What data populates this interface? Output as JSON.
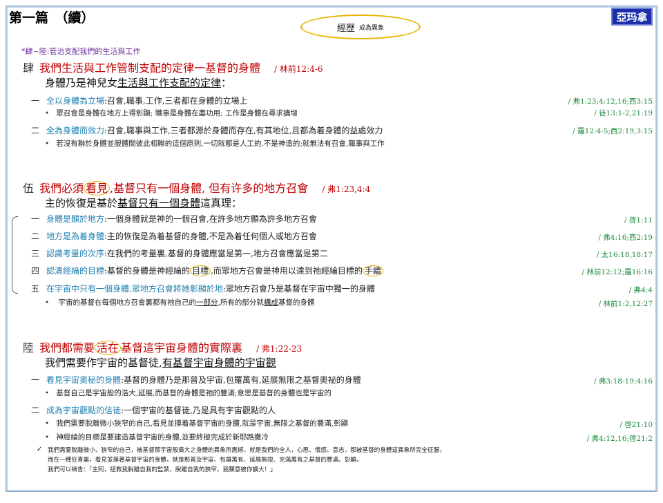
{
  "page": {
    "title": "第一篇　（續）",
    "logo": "亞玛拿"
  },
  "oval": {
    "main": "經歷",
    "sub": "成為異象"
  },
  "crumb": "*肆~陸:管治支配我們的生活與工作",
  "s4": {
    "num": "肆",
    "head": "我們生活與工作管制支配的定律一基督的身體",
    "ref": "/ 林前12:4-6",
    "subtitle_a": "身體乃是神兒女",
    "subtitle_u": "生活與工作支配的定律",
    "subtitle_b": "：",
    "i1": {
      "n": "一",
      "t": "全以身體為立場",
      "b": ":召會,職事,工作,三者都在身體的立場上",
      "ref": "/ 弗1:23;4:12,16;西3:15"
    },
    "b1": {
      "text": "眾召會是身體在地方上得彰顯; 職事是身體在盡功用; 工作是身體在尋求擴增",
      "ref": "/ 徒13:1-2,21:19"
    },
    "i2": {
      "n": "二",
      "t": "全為身體而效力",
      "b": ":召會,職事與工作,三者都源於身體而存在,有其地位,且都為着身體的益處效力",
      "ref": "/ 羅12:4-5;西2:19,3:15"
    },
    "b2": {
      "text": "若沒有聯於身體並服體間彼此相聯的這個原則,一切就都是人工的,不是神造的;就無法有召會,職事與工作"
    }
  },
  "s5": {
    "num": "伍",
    "head_a": "我們必須",
    "head_c": "看見",
    "head_b": ",基督只有一個身體, 但有许多的地方召會",
    "ref": "/ 弗1:23,4:4",
    "subtitle_a": "主的恢復是基於",
    "subtitle_u": "基督只有一個身體",
    "subtitle_b": "這真理：",
    "i1": {
      "n": "一",
      "t": "身體是顯於地方",
      "b": ":一個身體就是神的一個召會,在許多地方顯為許多地方召會",
      "ref": "/ 啓1:11"
    },
    "i2": {
      "n": "二",
      "t": "地方是為着身體",
      "b": ":主的恢復是為着基督的身體,不是為着任何個人或地方召會",
      "ref": "/ 弗4:16;西2:19"
    },
    "i3": {
      "n": "三",
      "t": "認識考量的次序",
      "b": ":在我們的考量裏,基督的身體應當是第一,地方召會應當是第二",
      "ref": "/ 太16:18,18:17"
    },
    "i4": {
      "n": "四",
      "t": "認清經綸的目標",
      "b_a": ":基督的身體是神經綸的",
      "b_c1": "目標",
      "b_b": ",而眾地方召會是神用以達到祂經綸目標的",
      "b_c2": "手續",
      "ref": "/ 林前12:12;羅16:16"
    },
    "i5": {
      "n": "五",
      "t": "在宇宙中只有一個身體,眾地方召會將她彰顯於地",
      "b": ":眾地方召會乃是基督在宇宙中獨一的身體",
      "ref": "/ 弗4:4"
    },
    "b1": {
      "a": "宇宙的基督在每個地方召會裏都有祂自己的",
      "u1": "一部分",
      "b": ",所有的部分就",
      "u2": "構成",
      "c": "基督的身體",
      "ref": "/ 林前1:2,12:27"
    }
  },
  "s6": {
    "num": "陸",
    "head_a": "我們都需要",
    "head_c": "活在",
    "head_b": "基督這宇宙身體的實際裏",
    "ref": "/ 弗1:22-23",
    "subtitle_a": "我們需要作宇宙的基督徒,",
    "subtitle_u": "有基督宇宙身體的宇宙觀",
    "i1": {
      "n": "一",
      "t": "看見宇宙奧秘的身體",
      "b": ":基督的身體乃是那普及宇宙,包羅萬有,延展無限之基督奧祕的身體",
      "ref": "/ 弗3:18-19;4:16"
    },
    "b1": {
      "text": "基督自己是宇宙般的浩大,延展,而基督的身體是祂的豐滿;意思是基督的身體也是宇宙的"
    },
    "i2": {
      "n": "二",
      "t": "成為宇宙觀點的信徒",
      "b": ":一個宇宙的基督徒,乃是具有宇宙觀點的人"
    },
    "b2": {
      "text": "我們需要脫離微小狹窄的自己,看見並摸着基督宇宙的身體,就是宇宙,無限之基督的豐滿,彰顯",
      "ref": "/ 啓21:10"
    },
    "b3": {
      "text": "神經綸的目標是要建造基督宇宙的身體,並要終極完成於新耶路撒冷",
      "ref": "/ 弗4:12,16;啓21:2"
    },
    "note1": "我們需要脫離微小、狹窄的自己，被基督那宇宙般廣大之身體的異象所震撼，就是我們的全人，心思、情感、意志，都被基督的身體這異象所完全征服，",
    "note2": "而在一種狂喜裏，看見並摸著基督宇宙的身體，就是那普及宇宙、包羅萬有、延展無限、充滿萬有之基督的豐滿、彰顯。",
    "note3": "我們可以禱告：「主阿，拯救我脫離自我的監禁，脫離自我的狹窄。我願意被你擴大！」"
  }
}
